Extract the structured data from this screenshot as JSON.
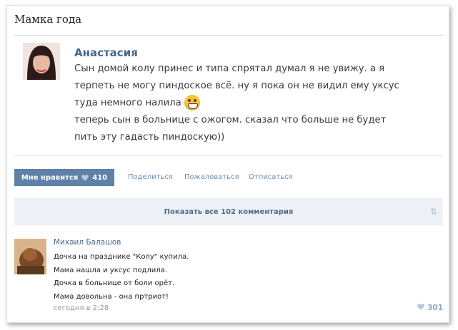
{
  "page": {
    "title": "Мамка года"
  },
  "post": {
    "author": "Анастасия",
    "text": "Сын домой колу принес и типа спрятал думал я не увижу. а я\nтерпеть не могу пиндоское всё. ну я пока он не видил ему уксус\nтуда немного налила",
    "text_after": "теперь сын в больнице с ожогом. сказал что больше не будет\nпить эту гадасть пиндоскую))",
    "emoji_icon": "grinning-emoji-icon"
  },
  "actions": {
    "like_label": "Мне нравится",
    "like_count": "410",
    "share": "Поделиться",
    "report": "Пожаловаться",
    "unsubscribe": "Отписаться"
  },
  "comments_bar": {
    "label": "Показать все 102 комментария"
  },
  "comment": {
    "author": "Михаил Балашов",
    "text": "Дочка на празднике \"Колу\" купила.\nМама нашла и уксус подлила.\nДочка в больнице от боли орёт.\nМама довольна - она пртриот!",
    "time": "сегодня в 2:28",
    "likes": "301"
  },
  "colors": {
    "link": "#45688e",
    "like_button": "#5e81a8",
    "comments_bar_bg": "#edf1f5"
  }
}
